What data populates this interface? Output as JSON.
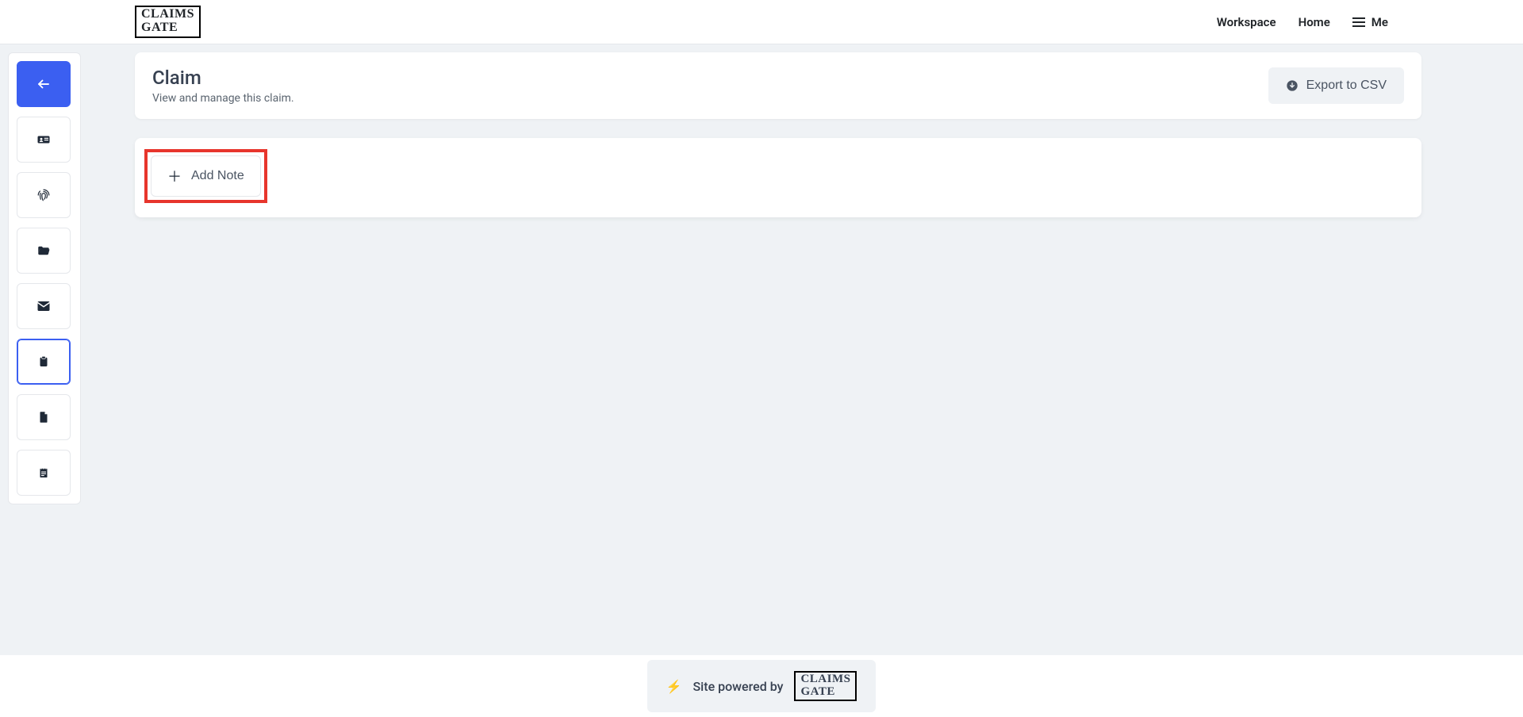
{
  "brand": {
    "line1": "CLAIMS",
    "line2": "GATE"
  },
  "nav": {
    "workspace": "Workspace",
    "home": "Home",
    "me": "Me"
  },
  "header": {
    "title": "Claim",
    "subtitle": "View and manage this claim.",
    "export_label": "Export to CSV"
  },
  "notes": {
    "add_label": "Add Note"
  },
  "footer": {
    "powered_by": "Site powered by"
  },
  "sidebar": {
    "items": [
      {
        "icon": "arrow-left-icon",
        "primary": true,
        "active": false
      },
      {
        "icon": "id-card-icon",
        "primary": false,
        "active": false
      },
      {
        "icon": "fingerprint-icon",
        "primary": false,
        "active": false
      },
      {
        "icon": "folder-open-icon",
        "primary": false,
        "active": false
      },
      {
        "icon": "envelope-icon",
        "primary": false,
        "active": false
      },
      {
        "icon": "clipboard-icon",
        "primary": false,
        "active": true
      },
      {
        "icon": "file-icon",
        "primary": false,
        "active": false
      },
      {
        "icon": "notepad-icon",
        "primary": false,
        "active": false
      }
    ]
  }
}
